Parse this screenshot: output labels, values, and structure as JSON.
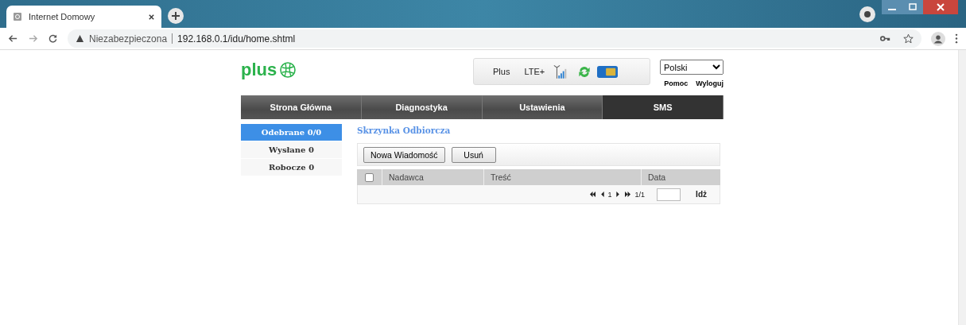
{
  "browser": {
    "tab_title": "Internet Domowy",
    "security": "Niezabezpieczona",
    "url": "192.168.0.1/idu/home.shtml"
  },
  "header": {
    "logo": "plus",
    "status": {
      "operator": "Plus",
      "network": "LTE+"
    },
    "language": "Polski",
    "links": [
      "Pomoc",
      "Wyloguj"
    ]
  },
  "nav": [
    {
      "label": "Strona Główna",
      "selected": false
    },
    {
      "label": "Diagnostyka",
      "selected": false
    },
    {
      "label": "Ustawienia",
      "selected": false
    },
    {
      "label": "SMS",
      "selected": true
    }
  ],
  "sidebar": [
    {
      "label": "Odebrane 0/0",
      "selected": true
    },
    {
      "label": "Wysłane 0",
      "selected": false
    },
    {
      "label": "Robocze 0",
      "selected": false
    }
  ],
  "main": {
    "title": "Skrzynka Odbiorcza",
    "buttons": [
      "Nowa Wiadomość",
      "Usuń"
    ],
    "table": {
      "select_all": false,
      "columns": [
        "Nadawca",
        "Treść",
        "Data"
      ]
    },
    "pager": {
      "page": "1",
      "total": "1/1",
      "go": "Idż"
    }
  }
}
